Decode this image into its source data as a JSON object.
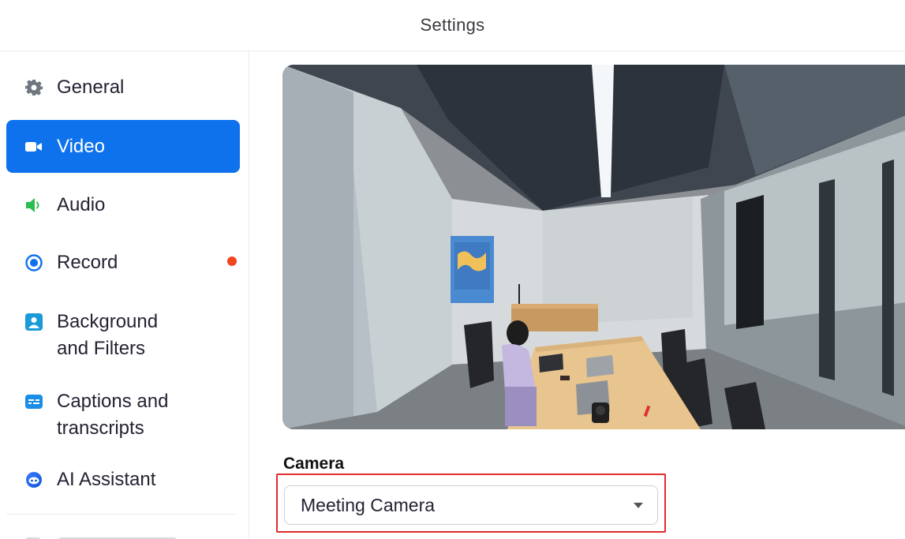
{
  "window": {
    "title": "Settings"
  },
  "sidebar": {
    "items": [
      {
        "label": "General",
        "icon": "gear-icon"
      },
      {
        "label": "Video",
        "icon": "video-camera-icon",
        "active": true
      },
      {
        "label": "Audio",
        "icon": "speaker-icon"
      },
      {
        "label": "Record",
        "icon": "record-icon",
        "badge": "notification-dot"
      },
      {
        "label": "Background\nand Filters",
        "icon": "background-icon"
      },
      {
        "label": "Captions and\ntranscripts",
        "icon": "captions-icon"
      },
      {
        "label": "AI Assistant",
        "icon": "ai-assistant-icon"
      }
    ]
  },
  "video": {
    "camera_label": "Camera",
    "camera_select": {
      "selected": "Meeting Camera"
    }
  },
  "colors": {
    "accent": "#0e72ed",
    "badge": "#f2441d",
    "highlight": "#e02b2b",
    "audio_icon": "#2dbd4e",
    "record_icon": "#0e72ed"
  }
}
